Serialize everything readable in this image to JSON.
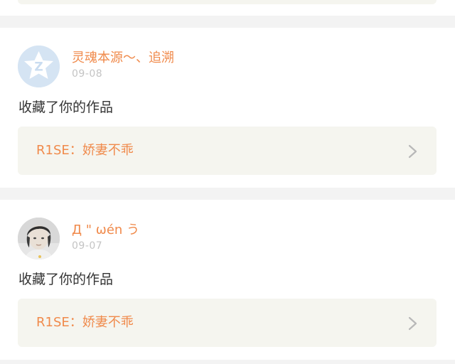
{
  "feed": {
    "items": [
      {
        "username": "灵魂本源～、追溯",
        "date": "09-08",
        "action": "收藏了你的作品",
        "work_title": "R1SE：娇妻不乖",
        "avatar_icon": "default-avatar-icon"
      },
      {
        "username": "Д \" ωén う",
        "date": "09-07",
        "action": "收藏了你的作品",
        "work_title": "R1SE：娇妻不乖",
        "avatar_icon": "user-photo-avatar"
      }
    ]
  },
  "colors": {
    "accent": "#f08a4b",
    "muted": "#c4c4c4",
    "card_bg": "#ffffff",
    "link_bg": "#f5f5ef",
    "page_bg": "#f3f3f3"
  }
}
